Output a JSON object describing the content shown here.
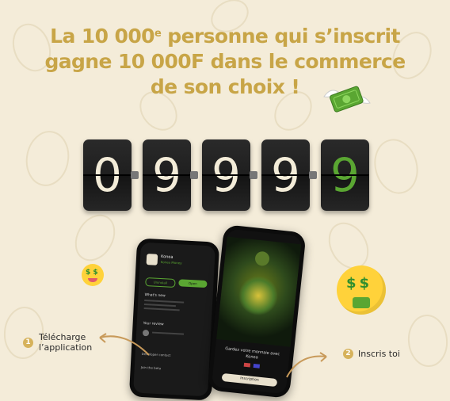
{
  "headline": {
    "part1": "La 10 000",
    "sup": "e",
    "part2": " personne qui s’inscrit",
    "line2": "gagne 10 000F dans le commerce",
    "line3": "de son choix !"
  },
  "counter": {
    "digits": [
      "0",
      "9",
      "9",
      "9",
      "9"
    ],
    "highlight_color": "#5aa632"
  },
  "phone1": {
    "app_name": "Konea",
    "app_sub": "Konea Money",
    "btn_uninstall": "Uninstall",
    "btn_open": "Open",
    "whats_new": "What's new",
    "reviews": "Your review",
    "dev_contact": "Developer contact",
    "beta": "Join the beta"
  },
  "phone2": {
    "tagline": "Gardez votre monnaie avec Konea",
    "button": "Inscription"
  },
  "steps": [
    {
      "num": "1",
      "line1": "Télécharge",
      "line2": "l’application"
    },
    {
      "num": "2",
      "line1": "Inscris toi"
    }
  ],
  "colors": {
    "gold": "#c8a547",
    "background": "#f4ecd9",
    "money_green": "#5aa632"
  },
  "icons": [
    "flying-money-icon",
    "money-face-emoji-icon",
    "money-face-emoji-small-icon",
    "arrow-icon"
  ]
}
